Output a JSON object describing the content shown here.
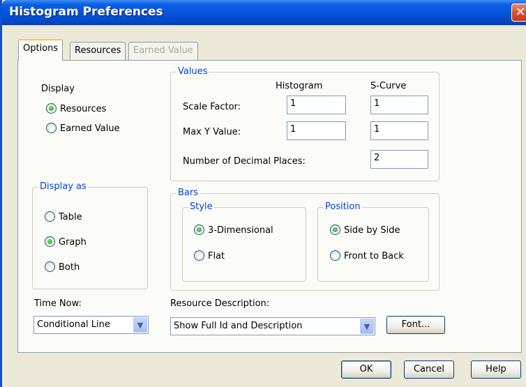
{
  "window": {
    "title": "Histogram Preferences",
    "close_symbol": "✕"
  },
  "tabs": [
    {
      "label": "Options",
      "state": "active"
    },
    {
      "label": "Resources",
      "state": "normal"
    },
    {
      "label": "Earned Value",
      "state": "disabled"
    }
  ],
  "display": {
    "label": "Display",
    "options": [
      {
        "label": "Resources",
        "checked": true
      },
      {
        "label": "Earned Value",
        "checked": false
      }
    ]
  },
  "values": {
    "title": "Values",
    "col_histogram": "Histogram",
    "col_scurve": "S-Curve",
    "scale_factor_label": "Scale Factor:",
    "scale_factor_histogram": "1",
    "scale_factor_scurve": "1",
    "max_y_label": "Max Y Value:",
    "max_y_histogram": "1",
    "max_y_scurve": "1",
    "decimal_places_label": "Number of Decimal Places:",
    "decimal_places": "2"
  },
  "display_as": {
    "title": "Display as",
    "options": [
      {
        "label": "Table",
        "checked": false
      },
      {
        "label": "Graph",
        "checked": true
      },
      {
        "label": "Both",
        "checked": false
      }
    ]
  },
  "bars": {
    "title": "Bars",
    "style": {
      "title": "Style",
      "options": [
        {
          "label": "3-Dimensional",
          "checked": true
        },
        {
          "label": "Flat",
          "checked": false
        }
      ]
    },
    "position": {
      "title": "Position",
      "options": [
        {
          "label": "Side by Side",
          "checked": true
        },
        {
          "label": "Front to Back",
          "checked": false
        }
      ]
    }
  },
  "time_now": {
    "label": "Time Now:",
    "selected": "Conditional Line"
  },
  "resource_description": {
    "label": "Resource Description:",
    "selected": "Show Full Id and Description"
  },
  "buttons": {
    "font": "Font...",
    "ok": "OK",
    "cancel": "Cancel",
    "help": "Help"
  },
  "colors": {
    "titlebar": "#0553d8",
    "group_title": "#0046d5",
    "dialog_bg": "#ece9d8",
    "radio_dot": "#21a121"
  }
}
